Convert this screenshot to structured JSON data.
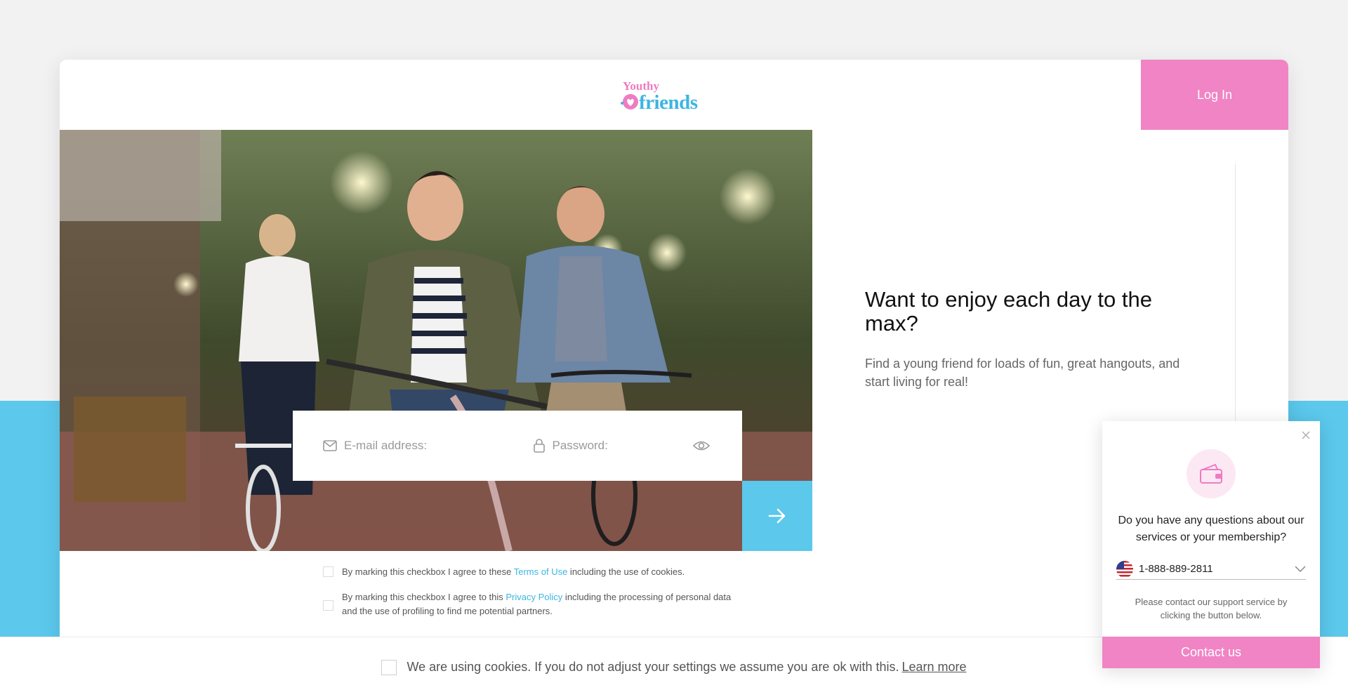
{
  "brand": {
    "logo_top": "Youthy",
    "logo_bottom": "friends"
  },
  "header": {
    "login_label": "Log In"
  },
  "login_form": {
    "email_placeholder": "E-mail address:",
    "password_placeholder": "Password:"
  },
  "consents": {
    "terms_prefix": "By marking this checkbox I agree to these ",
    "terms_link": "Terms of Use",
    "terms_suffix": " including the use of cookies.",
    "privacy_prefix": "By marking this checkbox I agree to this ",
    "privacy_link": "Privacy Policy",
    "privacy_suffix": " including the processing of personal data and the use of profiling to find me potential partners."
  },
  "promo": {
    "headline": "Want to enjoy each day to the max?",
    "subtext": "Find a young friend for loads of fun, great hangouts, and start living for real!"
  },
  "cookie_bar": {
    "text": "We are using cookies. If you do not adjust your settings we assume you are ok with this.",
    "link": "Learn more"
  },
  "support_widget": {
    "question": "Do you have any questions about our services or your membership?",
    "phone": "1-888-889-2811",
    "note": "Please contact our support service by clicking the button below.",
    "contact_label": "Contact us"
  },
  "colors": {
    "pink": "#f084c5",
    "blue": "#5bc8ec",
    "link": "#3db5e2"
  },
  "icons": [
    "envelope-icon",
    "lock-icon",
    "eye-icon",
    "arrow-right-icon",
    "wallet-icon",
    "close-icon",
    "us-flag-icon",
    "chevron-down-icon",
    "heart-logo-icon"
  ]
}
